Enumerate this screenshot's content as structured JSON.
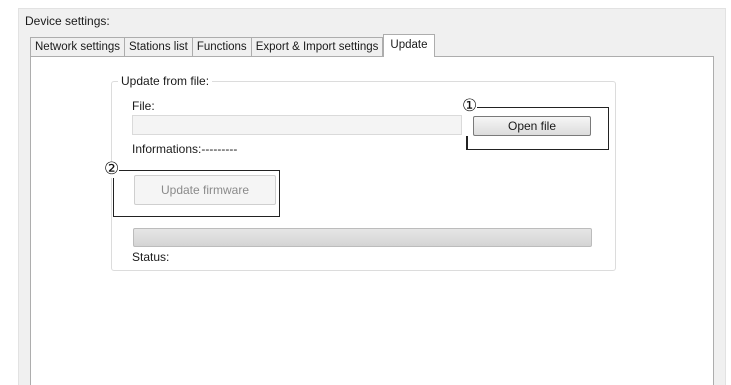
{
  "window": {
    "group_label": "Device settings:"
  },
  "tabs": [
    {
      "label": "Network settings",
      "active": false
    },
    {
      "label": "Stations list",
      "active": false
    },
    {
      "label": "Functions",
      "active": false
    },
    {
      "label": "Export & Import settings",
      "active": false
    },
    {
      "label": "Update",
      "active": true
    }
  ],
  "update_group": {
    "legend": "Update from file:",
    "file_label": "File:",
    "file_value": "",
    "info_label": "Informations:---------",
    "open_file_label": "Open file",
    "update_firmware_label": "Update firmware",
    "update_firmware_enabled": false,
    "progress": 0,
    "status_label": "Status:"
  },
  "annotations": [
    {
      "marker": "①"
    },
    {
      "marker": "②"
    }
  ]
}
